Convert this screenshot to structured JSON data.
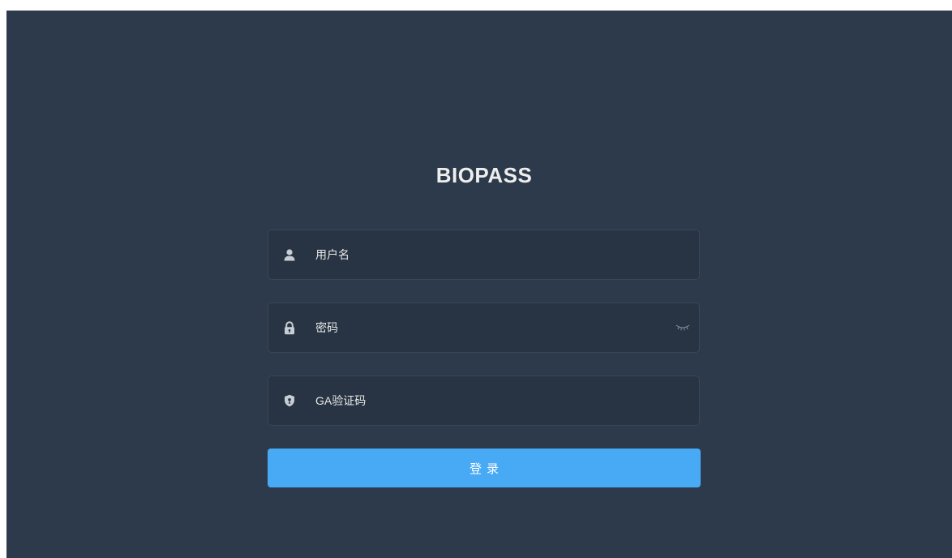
{
  "page": {
    "title": "BIOPASS"
  },
  "form": {
    "username": {
      "placeholder": "用户名",
      "value": "",
      "icon": "user-icon"
    },
    "password": {
      "placeholder": "密码",
      "value": "",
      "icon": "lock-icon",
      "toggle_icon": "eye-closed-icon"
    },
    "ga_code": {
      "placeholder": "GA验证码",
      "value": "",
      "icon": "shield-icon"
    },
    "login_label": "登录"
  },
  "colors": {
    "background": "#2d3a4b",
    "field_background": "#283443",
    "field_border": "#3a4656",
    "accent": "#48a9f5",
    "title_text": "#eeeeee",
    "icon": "#c7cdd5"
  }
}
